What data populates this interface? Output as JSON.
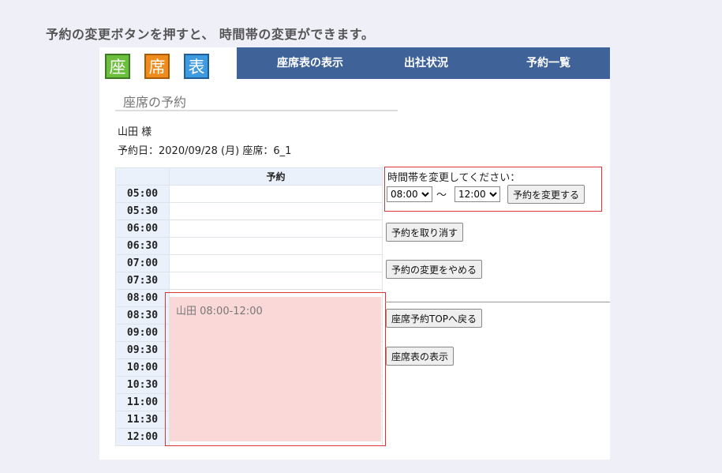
{
  "caption": "予約の変更ボタンを押すと、 時間帯の変更ができます。",
  "logo": {
    "chars": [
      "座",
      "席",
      "表"
    ],
    "colors": [
      "#6cbf3c",
      "#f08c1e",
      "#3f9be0"
    ]
  },
  "nav": {
    "items": [
      "座席表の表示",
      "出社状況",
      "予約一覧"
    ]
  },
  "section_title": "座席の予約",
  "user_label": "山田 様",
  "reservation_info": "予約日：2020/09/28 (月) 座席：6_1",
  "schedule": {
    "column_header": "予約",
    "times": [
      "05:00",
      "05:30",
      "06:00",
      "06:30",
      "07:00",
      "07:30",
      "08:00",
      "08:30",
      "09:00",
      "09:30",
      "10:00",
      "10:30",
      "11:00",
      "11:30",
      "12:00"
    ],
    "booking_label": "山田 08:00-12:00"
  },
  "change": {
    "prompt": "時間帯を変更してください：",
    "start_value": "08:00",
    "end_value": "12:00",
    "separator": "～",
    "submit_label": "予約を変更する"
  },
  "buttons": {
    "cancel_reservation": "予約を取り消す",
    "stop_change": "予約の変更をやめる",
    "back_top": "座席予約TOPへ戻る",
    "show_seatmap": "座席表の表示"
  },
  "colors": {
    "nav_bg": "#3f6299",
    "booking_fill": "#fbd8d8",
    "highlight_border": "#dd3333"
  }
}
